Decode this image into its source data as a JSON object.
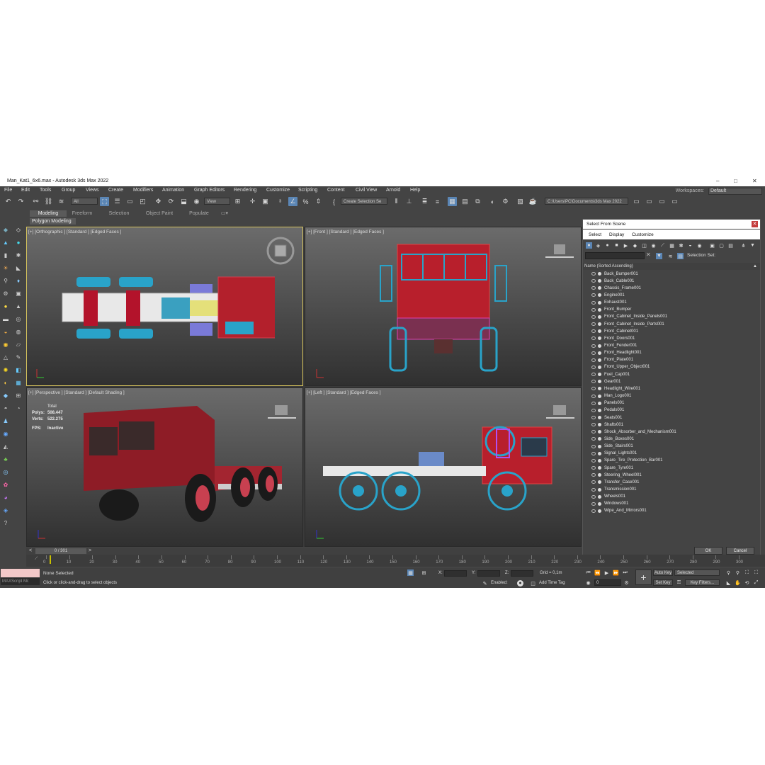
{
  "window": {
    "title": "Man_Kat1_6x6.max - Autodesk 3ds Max 2022",
    "min": "–",
    "max": "□",
    "close": "✕"
  },
  "menu": [
    "File",
    "Edit",
    "Tools",
    "Group",
    "Views",
    "Create",
    "Modifiers",
    "Animation",
    "Graph Editors",
    "Rendering",
    "Customize",
    "Scripting",
    "Content",
    "Civil View",
    "Arnold",
    "Help"
  ],
  "workspaces": {
    "label": "Workspaces:",
    "value": "Default"
  },
  "toolbar": {
    "filter": "All",
    "refcoord": "View",
    "selection_set": "Create Selection Se",
    "path": "C:\\Users\\PC\\Documents\\3ds Max 2022"
  },
  "ribbon": {
    "tabs": [
      "Modeling",
      "Freeform",
      "Selection",
      "Object Paint",
      "Populate"
    ],
    "active": "Modeling",
    "panel": "Polygon Modeling"
  },
  "viewports": {
    "top_left": {
      "label": "[+] [Orthographic ] [Standard ] [Edged Faces ]"
    },
    "top_right": {
      "label": "[+] [Front ] [Standard ] [Edged Faces ]"
    },
    "bottom_left": {
      "label": "[+] [Perspective ] [Standard ] [Default Shading ]",
      "stats": {
        "total": "Total",
        "polys_label": "Polys:",
        "polys": "508.447",
        "verts_label": "Verts:",
        "verts": "522.275",
        "fps_label": "FPS:",
        "fps": "Inactive"
      }
    },
    "bottom_right": {
      "label": "[+] [Left ] [Standard ] [Edged Faces ]"
    }
  },
  "dialog": {
    "title": "Select From Scene",
    "menu": [
      "Select",
      "Display",
      "Customize"
    ],
    "selection_set_label": "Selection Set:",
    "column": "Name (Sorted Ascending)",
    "items": [
      "Back_Bumper001",
      "Back_Cable001",
      "Chassis_Frame001",
      "Engine001",
      "Exhaust001",
      "Front_Bumper",
      "Front_Cabinet_Inside_Panels001",
      "Front_Cabinet_Inside_Parts001",
      "Front_Cabinet001",
      "Front_Doors001",
      "Front_Fender001",
      "Front_Headlight001",
      "Front_Plate001",
      "Front_Upper_Object001",
      "Fuel_Cap001",
      "Gear001",
      "Headlight_Wire001",
      "Man_Logo001",
      "Panels001",
      "Pedals001",
      "Seats001",
      "Shafts001",
      "Shock_Absorber_and_Mechanism001",
      "Side_Boxes001",
      "Side_Stairs001",
      "Signal_Lights001",
      "Spare_Tire_Protection_Bar001",
      "Spare_Tyre001",
      "Steering_Wheel001",
      "Transfer_Case001",
      "Transmission001",
      "Wheels001",
      "Windows001",
      "Wipe_And_Mirrors001"
    ],
    "ok": "OK",
    "cancel": "Cancel"
  },
  "timeline": {
    "slider": "0 / 301",
    "ticks": [
      "0",
      "10",
      "20",
      "30",
      "40",
      "50",
      "60",
      "70",
      "80",
      "90",
      "100",
      "110",
      "120",
      "130",
      "140",
      "150",
      "160",
      "170",
      "180",
      "190",
      "200",
      "210",
      "220",
      "230",
      "240",
      "250",
      "260",
      "270",
      "280",
      "290",
      "300"
    ]
  },
  "status": {
    "maxscript": "MAXScript Mi:",
    "selection": "None Selected",
    "prompt": "Click or click-and-drag to select objects",
    "x_label": "X:",
    "y_label": "Y:",
    "z_label": "Z:",
    "grid": "Grid = 0,1m",
    "enabled": "Enabled:",
    "add_time_tag": "Add Time Tag",
    "auto_key": "Auto Key",
    "set_key": "Set Key",
    "selected": "Selected",
    "frame": "0",
    "key_filters": "Key Filters..."
  }
}
